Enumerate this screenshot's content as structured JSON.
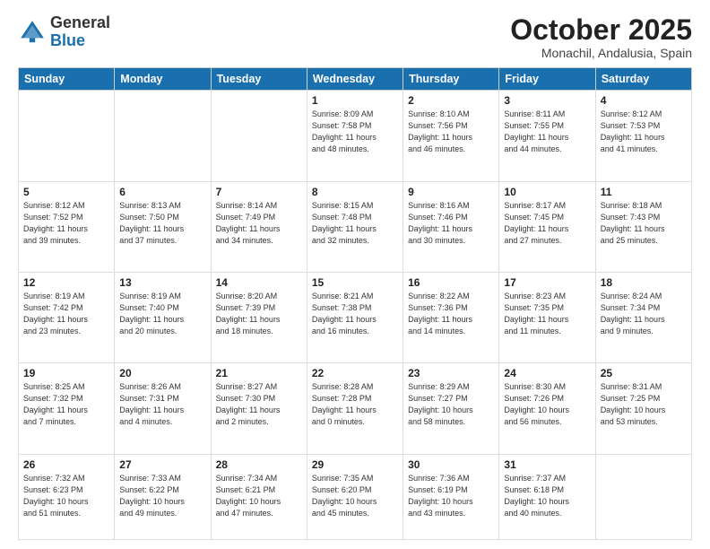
{
  "header": {
    "logo_general": "General",
    "logo_blue": "Blue",
    "month_title": "October 2025",
    "location": "Monachil, Andalusia, Spain"
  },
  "days_of_week": [
    "Sunday",
    "Monday",
    "Tuesday",
    "Wednesday",
    "Thursday",
    "Friday",
    "Saturday"
  ],
  "weeks": [
    [
      {
        "day": "",
        "info": ""
      },
      {
        "day": "",
        "info": ""
      },
      {
        "day": "",
        "info": ""
      },
      {
        "day": "1",
        "info": "Sunrise: 8:09 AM\nSunset: 7:58 PM\nDaylight: 11 hours\nand 48 minutes."
      },
      {
        "day": "2",
        "info": "Sunrise: 8:10 AM\nSunset: 7:56 PM\nDaylight: 11 hours\nand 46 minutes."
      },
      {
        "day": "3",
        "info": "Sunrise: 8:11 AM\nSunset: 7:55 PM\nDaylight: 11 hours\nand 44 minutes."
      },
      {
        "day": "4",
        "info": "Sunrise: 8:12 AM\nSunset: 7:53 PM\nDaylight: 11 hours\nand 41 minutes."
      }
    ],
    [
      {
        "day": "5",
        "info": "Sunrise: 8:12 AM\nSunset: 7:52 PM\nDaylight: 11 hours\nand 39 minutes."
      },
      {
        "day": "6",
        "info": "Sunrise: 8:13 AM\nSunset: 7:50 PM\nDaylight: 11 hours\nand 37 minutes."
      },
      {
        "day": "7",
        "info": "Sunrise: 8:14 AM\nSunset: 7:49 PM\nDaylight: 11 hours\nand 34 minutes."
      },
      {
        "day": "8",
        "info": "Sunrise: 8:15 AM\nSunset: 7:48 PM\nDaylight: 11 hours\nand 32 minutes."
      },
      {
        "day": "9",
        "info": "Sunrise: 8:16 AM\nSunset: 7:46 PM\nDaylight: 11 hours\nand 30 minutes."
      },
      {
        "day": "10",
        "info": "Sunrise: 8:17 AM\nSunset: 7:45 PM\nDaylight: 11 hours\nand 27 minutes."
      },
      {
        "day": "11",
        "info": "Sunrise: 8:18 AM\nSunset: 7:43 PM\nDaylight: 11 hours\nand 25 minutes."
      }
    ],
    [
      {
        "day": "12",
        "info": "Sunrise: 8:19 AM\nSunset: 7:42 PM\nDaylight: 11 hours\nand 23 minutes."
      },
      {
        "day": "13",
        "info": "Sunrise: 8:19 AM\nSunset: 7:40 PM\nDaylight: 11 hours\nand 20 minutes."
      },
      {
        "day": "14",
        "info": "Sunrise: 8:20 AM\nSunset: 7:39 PM\nDaylight: 11 hours\nand 18 minutes."
      },
      {
        "day": "15",
        "info": "Sunrise: 8:21 AM\nSunset: 7:38 PM\nDaylight: 11 hours\nand 16 minutes."
      },
      {
        "day": "16",
        "info": "Sunrise: 8:22 AM\nSunset: 7:36 PM\nDaylight: 11 hours\nand 14 minutes."
      },
      {
        "day": "17",
        "info": "Sunrise: 8:23 AM\nSunset: 7:35 PM\nDaylight: 11 hours\nand 11 minutes."
      },
      {
        "day": "18",
        "info": "Sunrise: 8:24 AM\nSunset: 7:34 PM\nDaylight: 11 hours\nand 9 minutes."
      }
    ],
    [
      {
        "day": "19",
        "info": "Sunrise: 8:25 AM\nSunset: 7:32 PM\nDaylight: 11 hours\nand 7 minutes."
      },
      {
        "day": "20",
        "info": "Sunrise: 8:26 AM\nSunset: 7:31 PM\nDaylight: 11 hours\nand 4 minutes."
      },
      {
        "day": "21",
        "info": "Sunrise: 8:27 AM\nSunset: 7:30 PM\nDaylight: 11 hours\nand 2 minutes."
      },
      {
        "day": "22",
        "info": "Sunrise: 8:28 AM\nSunset: 7:28 PM\nDaylight: 11 hours\nand 0 minutes."
      },
      {
        "day": "23",
        "info": "Sunrise: 8:29 AM\nSunset: 7:27 PM\nDaylight: 10 hours\nand 58 minutes."
      },
      {
        "day": "24",
        "info": "Sunrise: 8:30 AM\nSunset: 7:26 PM\nDaylight: 10 hours\nand 56 minutes."
      },
      {
        "day": "25",
        "info": "Sunrise: 8:31 AM\nSunset: 7:25 PM\nDaylight: 10 hours\nand 53 minutes."
      }
    ],
    [
      {
        "day": "26",
        "info": "Sunrise: 7:32 AM\nSunset: 6:23 PM\nDaylight: 10 hours\nand 51 minutes."
      },
      {
        "day": "27",
        "info": "Sunrise: 7:33 AM\nSunset: 6:22 PM\nDaylight: 10 hours\nand 49 minutes."
      },
      {
        "day": "28",
        "info": "Sunrise: 7:34 AM\nSunset: 6:21 PM\nDaylight: 10 hours\nand 47 minutes."
      },
      {
        "day": "29",
        "info": "Sunrise: 7:35 AM\nSunset: 6:20 PM\nDaylight: 10 hours\nand 45 minutes."
      },
      {
        "day": "30",
        "info": "Sunrise: 7:36 AM\nSunset: 6:19 PM\nDaylight: 10 hours\nand 43 minutes."
      },
      {
        "day": "31",
        "info": "Sunrise: 7:37 AM\nSunset: 6:18 PM\nDaylight: 10 hours\nand 40 minutes."
      },
      {
        "day": "",
        "info": ""
      }
    ]
  ]
}
